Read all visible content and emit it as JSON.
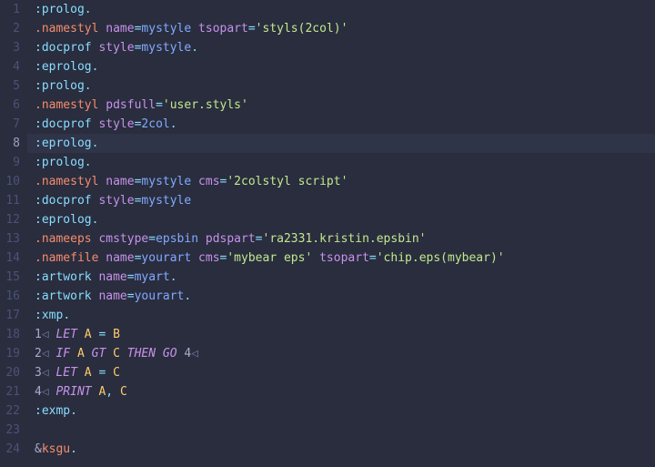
{
  "editor": {
    "active_line": 8,
    "lines": [
      {
        "n": 1,
        "tokens": [
          {
            "t": ":prolog",
            "c": "tok-tag"
          },
          {
            "t": ".",
            "c": "tok-op"
          }
        ]
      },
      {
        "n": 2,
        "tokens": [
          {
            "t": ".namestyl",
            "c": "tok-dir"
          },
          {
            "t": " ",
            "c": "plain"
          },
          {
            "t": "name",
            "c": "tok-attr"
          },
          {
            "t": "=",
            "c": "tok-op"
          },
          {
            "t": "mystyle",
            "c": "tok-ident"
          },
          {
            "t": " ",
            "c": "plain"
          },
          {
            "t": "tsopart",
            "c": "tok-attr"
          },
          {
            "t": "=",
            "c": "tok-op"
          },
          {
            "t": "'styls(2col)'",
            "c": "tok-str"
          }
        ]
      },
      {
        "n": 3,
        "tokens": [
          {
            "t": ":docprof",
            "c": "tok-tag"
          },
          {
            "t": " ",
            "c": "plain"
          },
          {
            "t": "style",
            "c": "tok-attr"
          },
          {
            "t": "=",
            "c": "tok-op"
          },
          {
            "t": "mystyle",
            "c": "tok-ident"
          },
          {
            "t": ".",
            "c": "tok-op"
          }
        ]
      },
      {
        "n": 4,
        "tokens": [
          {
            "t": ":eprolog",
            "c": "tok-tag"
          },
          {
            "t": ".",
            "c": "tok-op"
          }
        ]
      },
      {
        "n": 5,
        "tokens": [
          {
            "t": ":prolog",
            "c": "tok-tag"
          },
          {
            "t": ".",
            "c": "tok-op"
          }
        ]
      },
      {
        "n": 6,
        "tokens": [
          {
            "t": ".namestyl",
            "c": "tok-dir"
          },
          {
            "t": " ",
            "c": "plain"
          },
          {
            "t": "pdsfull",
            "c": "tok-attr"
          },
          {
            "t": "=",
            "c": "tok-op"
          },
          {
            "t": "'user.styls'",
            "c": "tok-str"
          }
        ]
      },
      {
        "n": 7,
        "tokens": [
          {
            "t": ":docprof",
            "c": "tok-tag"
          },
          {
            "t": " ",
            "c": "plain"
          },
          {
            "t": "style",
            "c": "tok-attr"
          },
          {
            "t": "=",
            "c": "tok-op"
          },
          {
            "t": "2col",
            "c": "tok-ident"
          },
          {
            "t": ".",
            "c": "tok-op"
          }
        ]
      },
      {
        "n": 8,
        "tokens": [
          {
            "t": ":eprolog",
            "c": "tok-tag"
          },
          {
            "t": ".",
            "c": "tok-op"
          }
        ]
      },
      {
        "n": 9,
        "tokens": [
          {
            "t": ":prolog",
            "c": "tok-tag"
          },
          {
            "t": ".",
            "c": "tok-op"
          }
        ]
      },
      {
        "n": 10,
        "tokens": [
          {
            "t": ".namestyl",
            "c": "tok-dir"
          },
          {
            "t": " ",
            "c": "plain"
          },
          {
            "t": "name",
            "c": "tok-attr"
          },
          {
            "t": "=",
            "c": "tok-op"
          },
          {
            "t": "mystyle",
            "c": "tok-ident"
          },
          {
            "t": " ",
            "c": "plain"
          },
          {
            "t": "cms",
            "c": "tok-attr"
          },
          {
            "t": "=",
            "c": "tok-op"
          },
          {
            "t": "'2colstyl script'",
            "c": "tok-str"
          }
        ]
      },
      {
        "n": 11,
        "tokens": [
          {
            "t": ":docprof",
            "c": "tok-tag"
          },
          {
            "t": " ",
            "c": "plain"
          },
          {
            "t": "style",
            "c": "tok-attr"
          },
          {
            "t": "=",
            "c": "tok-op"
          },
          {
            "t": "mystyle",
            "c": "tok-ident"
          }
        ]
      },
      {
        "n": 12,
        "tokens": [
          {
            "t": ":eprolog",
            "c": "tok-tag"
          },
          {
            "t": ".",
            "c": "tok-op"
          }
        ]
      },
      {
        "n": 13,
        "tokens": [
          {
            "t": ".nameeps",
            "c": "tok-dir"
          },
          {
            "t": " ",
            "c": "plain"
          },
          {
            "t": "cmstype",
            "c": "tok-attr"
          },
          {
            "t": "=",
            "c": "tok-op"
          },
          {
            "t": "epsbin",
            "c": "tok-ident"
          },
          {
            "t": " ",
            "c": "plain"
          },
          {
            "t": "pdspart",
            "c": "tok-attr"
          },
          {
            "t": "=",
            "c": "tok-op"
          },
          {
            "t": "'ra2331.kristin.epsbin'",
            "c": "tok-str"
          }
        ]
      },
      {
        "n": 14,
        "tokens": [
          {
            "t": ".namefile",
            "c": "tok-dir"
          },
          {
            "t": " ",
            "c": "plain"
          },
          {
            "t": "name",
            "c": "tok-attr"
          },
          {
            "t": "=",
            "c": "tok-op"
          },
          {
            "t": "yourart",
            "c": "tok-ident"
          },
          {
            "t": " ",
            "c": "plain"
          },
          {
            "t": "cms",
            "c": "tok-attr"
          },
          {
            "t": "=",
            "c": "tok-op"
          },
          {
            "t": "'mybear eps'",
            "c": "tok-str"
          },
          {
            "t": " ",
            "c": "plain"
          },
          {
            "t": "tsopart",
            "c": "tok-attr"
          },
          {
            "t": "=",
            "c": "tok-op"
          },
          {
            "t": "'chip.eps(mybear)'",
            "c": "tok-str"
          }
        ]
      },
      {
        "n": 15,
        "tokens": [
          {
            "t": ":artwork",
            "c": "tok-tag"
          },
          {
            "t": " ",
            "c": "plain"
          },
          {
            "t": "name",
            "c": "tok-attr"
          },
          {
            "t": "=",
            "c": "tok-op"
          },
          {
            "t": "myart",
            "c": "tok-ident"
          },
          {
            "t": ".",
            "c": "tok-op"
          }
        ]
      },
      {
        "n": 16,
        "tokens": [
          {
            "t": ":artwork",
            "c": "tok-tag"
          },
          {
            "t": " ",
            "c": "plain"
          },
          {
            "t": "name",
            "c": "tok-attr"
          },
          {
            "t": "=",
            "c": "tok-op"
          },
          {
            "t": "yourart",
            "c": "tok-ident"
          },
          {
            "t": ".",
            "c": "tok-op"
          }
        ]
      },
      {
        "n": 17,
        "tokens": [
          {
            "t": ":xmp",
            "c": "tok-tag"
          },
          {
            "t": ".",
            "c": "tok-op"
          }
        ]
      },
      {
        "n": 18,
        "tokens": [
          {
            "t": "1",
            "c": "plain"
          },
          {
            "t": "◁",
            "c": "sym"
          },
          {
            "t": " ",
            "c": "plain"
          },
          {
            "t": "LET",
            "c": "tok-kw"
          },
          {
            "t": " ",
            "c": "plain"
          },
          {
            "t": "A",
            "c": "tok-var"
          },
          {
            "t": " ",
            "c": "plain"
          },
          {
            "t": "=",
            "c": "tok-op"
          },
          {
            "t": " ",
            "c": "plain"
          },
          {
            "t": "B",
            "c": "tok-var"
          }
        ]
      },
      {
        "n": 19,
        "tokens": [
          {
            "t": "2",
            "c": "plain"
          },
          {
            "t": "◁",
            "c": "sym"
          },
          {
            "t": " ",
            "c": "plain"
          },
          {
            "t": "IF",
            "c": "tok-kw"
          },
          {
            "t": " ",
            "c": "plain"
          },
          {
            "t": "A",
            "c": "tok-var"
          },
          {
            "t": " ",
            "c": "plain"
          },
          {
            "t": "GT",
            "c": "tok-kw"
          },
          {
            "t": " ",
            "c": "plain"
          },
          {
            "t": "C",
            "c": "tok-var"
          },
          {
            "t": " ",
            "c": "plain"
          },
          {
            "t": "THEN",
            "c": "tok-kw"
          },
          {
            "t": " ",
            "c": "plain"
          },
          {
            "t": "GO",
            "c": "tok-kw"
          },
          {
            "t": " ",
            "c": "plain"
          },
          {
            "t": "4",
            "c": "plain"
          },
          {
            "t": "◁",
            "c": "sym"
          }
        ]
      },
      {
        "n": 20,
        "tokens": [
          {
            "t": "3",
            "c": "plain"
          },
          {
            "t": "◁",
            "c": "sym"
          },
          {
            "t": " ",
            "c": "plain"
          },
          {
            "t": "LET",
            "c": "tok-kw"
          },
          {
            "t": " ",
            "c": "plain"
          },
          {
            "t": "A",
            "c": "tok-var"
          },
          {
            "t": " ",
            "c": "plain"
          },
          {
            "t": "=",
            "c": "tok-op"
          },
          {
            "t": " ",
            "c": "plain"
          },
          {
            "t": "C",
            "c": "tok-var"
          }
        ]
      },
      {
        "n": 21,
        "tokens": [
          {
            "t": "4",
            "c": "plain"
          },
          {
            "t": "◁",
            "c": "sym"
          },
          {
            "t": " ",
            "c": "plain"
          },
          {
            "t": "PRINT",
            "c": "tok-kw"
          },
          {
            "t": " ",
            "c": "plain"
          },
          {
            "t": "A",
            "c": "tok-var"
          },
          {
            "t": ",",
            "c": "tok-op"
          },
          {
            "t": " ",
            "c": "plain"
          },
          {
            "t": "C",
            "c": "tok-var"
          }
        ]
      },
      {
        "n": 22,
        "tokens": [
          {
            "t": ":exmp",
            "c": "tok-tag"
          },
          {
            "t": ".",
            "c": "tok-op"
          }
        ]
      },
      {
        "n": 23,
        "tokens": []
      },
      {
        "n": 24,
        "tokens": [
          {
            "t": "&",
            "c": "tok-amp"
          },
          {
            "t": "ksgu",
            "c": "tok-dir"
          },
          {
            "t": ".",
            "c": "tok-op"
          }
        ]
      }
    ]
  }
}
